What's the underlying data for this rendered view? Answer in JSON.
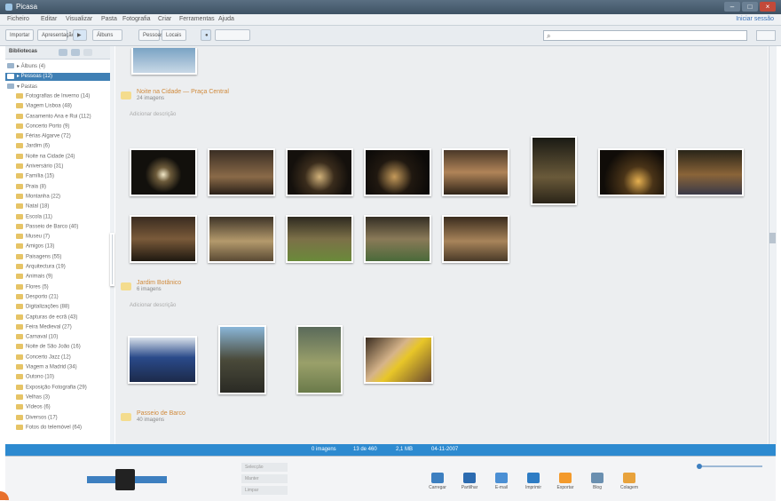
{
  "window": {
    "title": "Picasa"
  },
  "menu": {
    "items": [
      "Ficheiro",
      "Editar",
      "Visualizar",
      "Pasta",
      "Fotografia",
      "Criar",
      "Ferramentas",
      "Ajuda"
    ],
    "account_link": "Iniciar sessão"
  },
  "toolbar": {
    "import_label": "Importar",
    "slideshow_label": "Apresentação",
    "albums_label": "Álbuns",
    "people_label": "Pessoas",
    "places_label": "Locais",
    "search_placeholder": ""
  },
  "sidebar": {
    "title": "Bibliotecas",
    "items": [
      {
        "label": "▸ Álbuns (4)"
      },
      {
        "label": "▸ Pessoas (12)"
      },
      {
        "label": "▾ Pastas"
      },
      {
        "label": "Fotografias de Inverno (14)"
      },
      {
        "label": "Viagem Lisboa (48)"
      },
      {
        "label": "Casamento Ana e Rui (112)"
      },
      {
        "label": "Concerto Porto (9)"
      },
      {
        "label": "Férias Algarve (72)"
      },
      {
        "label": "Jardim (6)"
      },
      {
        "label": "Noite na Cidade (24)"
      },
      {
        "label": "Aniversário (31)"
      },
      {
        "label": "Família (15)"
      },
      {
        "label": "Praia (8)"
      },
      {
        "label": "Montanha (22)"
      },
      {
        "label": "Natal (18)"
      },
      {
        "label": "Escola (11)"
      },
      {
        "label": "Passeio de Barco (40)"
      },
      {
        "label": "Museu (7)"
      },
      {
        "label": "Amigos (13)"
      },
      {
        "label": "Paisagens (55)"
      },
      {
        "label": "Arquitectura (19)"
      },
      {
        "label": "Animais (9)"
      },
      {
        "label": "Flores (5)"
      },
      {
        "label": "Desporto (21)"
      },
      {
        "label": "Digitalizações (88)"
      },
      {
        "label": "Capturas de ecrã (43)"
      },
      {
        "label": "Feira Medieval (27)"
      },
      {
        "label": "Carnaval (10)"
      },
      {
        "label": "Noite de São João (16)"
      },
      {
        "label": "Concerto Jazz (12)"
      },
      {
        "label": "Viagem a Madrid (34)"
      },
      {
        "label": "Outono (10)"
      },
      {
        "label": "Exposição Fotografia (29)"
      },
      {
        "label": "Velhas (3)"
      },
      {
        "label": "Vídeos (6)"
      },
      {
        "label": "Diversos (17)"
      },
      {
        "label": "Fotos do telemóvel (64)"
      }
    ]
  },
  "groups": [
    {
      "name": "Noite na Cidade — Praça Central",
      "count": "24 imagens",
      "tag": "",
      "sub": "Adicionar descrição"
    },
    {
      "name": "Jardim Botânico",
      "count": "6 imagens",
      "tag": "",
      "sub": "Adicionar descrição"
    },
    {
      "name": "Passeio de Barco",
      "count": "40 imagens",
      "tag": "",
      "sub": ""
    }
  ],
  "status": {
    "selected": "0 imagens",
    "count": "13 de 460",
    "size": "2,1 MB",
    "date": "04-11-2007"
  },
  "tray": {
    "mid_items": [
      "Selecção",
      "Manter",
      "Limpar"
    ],
    "actions": [
      {
        "label": "Carregar",
        "color": "#3d7fc0"
      },
      {
        "label": "Partilhar",
        "color": "#2c6bb0"
      },
      {
        "label": "E-mail",
        "color": "#4b8fd4"
      },
      {
        "label": "Imprimir",
        "color": "#2e7cc4"
      },
      {
        "label": "Exportar",
        "color": "#f39a2c"
      },
      {
        "label": "Blog",
        "color": "#6a8fb0"
      },
      {
        "label": "Colagem",
        "color": "#e8a23c"
      }
    ]
  },
  "colors": {
    "accent": "#2d8ad0",
    "selection": "#3f7fb4",
    "group_title": "#d08a3c"
  }
}
